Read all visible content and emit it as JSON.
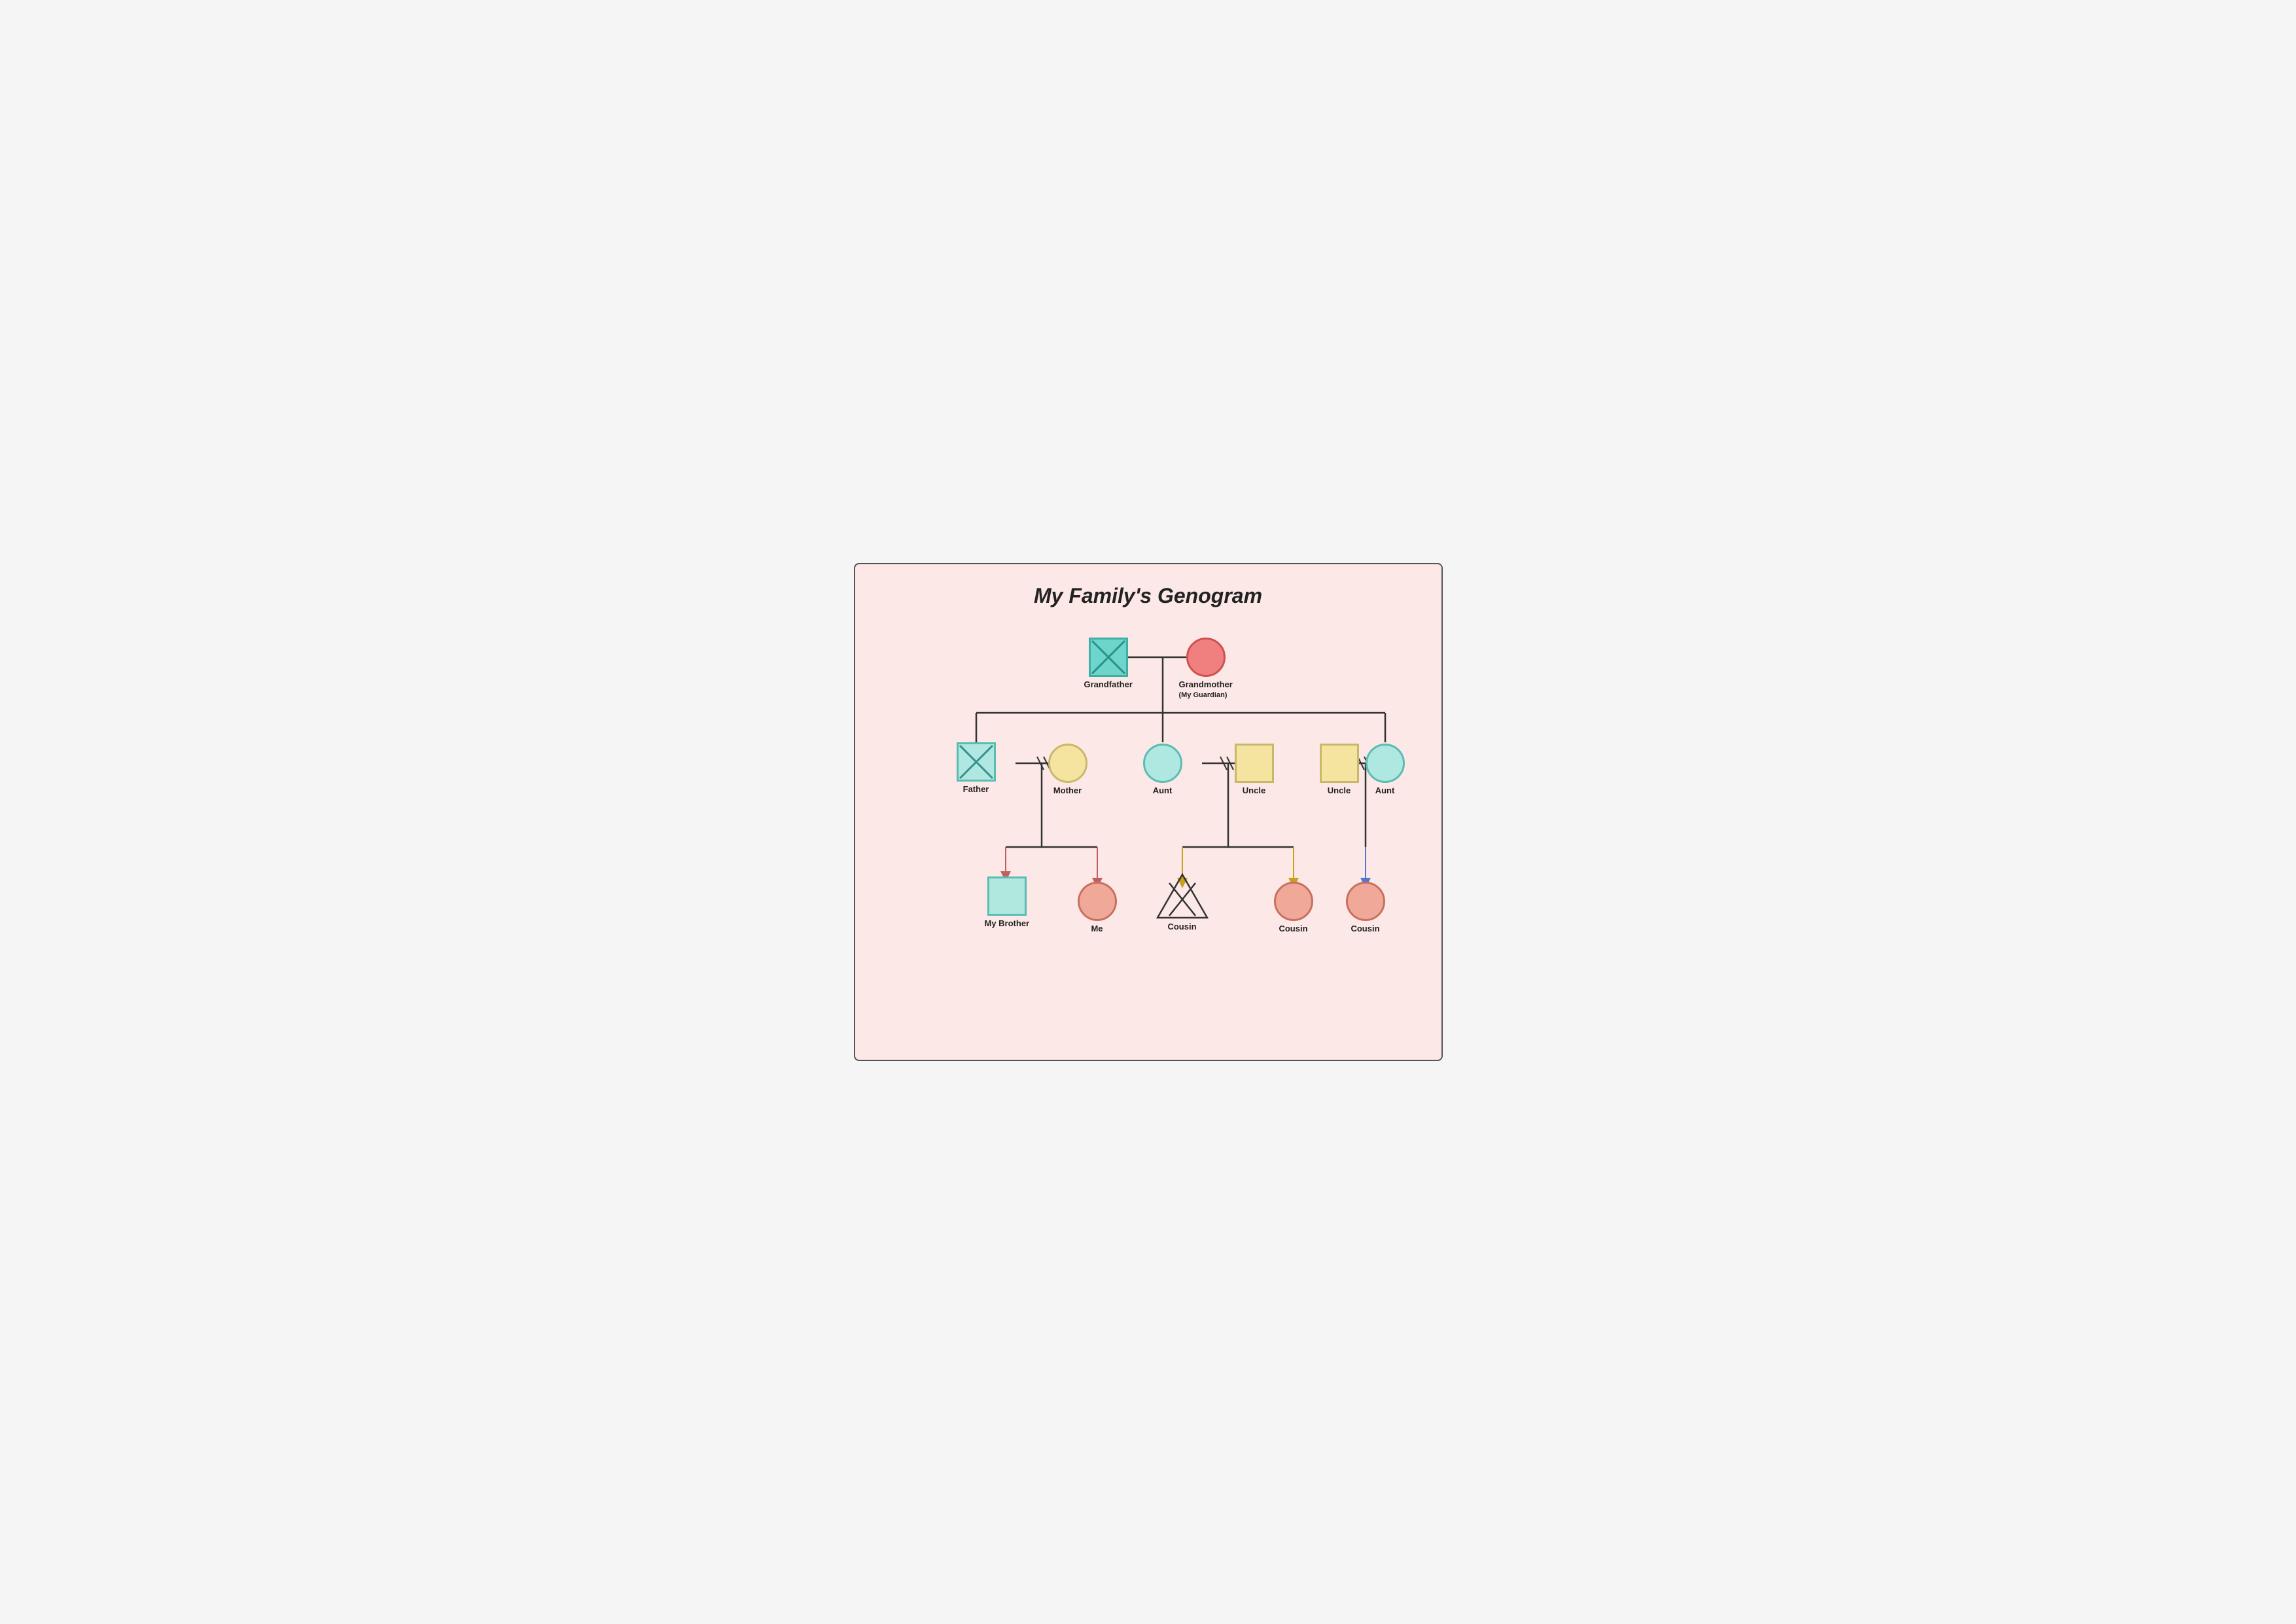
{
  "title": "My Family's Genogram",
  "nodes": {
    "grandfather": {
      "label": "Grandfather",
      "shape": "square-x",
      "color": "teal"
    },
    "grandmother": {
      "label": "Grandmother\n(My Guardian)",
      "shape": "circle",
      "color": "red"
    },
    "father": {
      "label": "Father",
      "shape": "square-x",
      "color": "light-teal"
    },
    "mother": {
      "label": "Mother",
      "shape": "circle",
      "color": "yellow"
    },
    "aunt1": {
      "label": "Aunt",
      "shape": "circle",
      "color": "teal"
    },
    "uncle1": {
      "label": "Uncle",
      "shape": "square",
      "color": "yellow"
    },
    "uncle2": {
      "label": "Uncle",
      "shape": "square",
      "color": "yellow"
    },
    "aunt2": {
      "label": "Aunt",
      "shape": "circle",
      "color": "teal"
    },
    "my_brother": {
      "label": "My Brother",
      "shape": "square",
      "color": "light-teal"
    },
    "me": {
      "label": "Me",
      "shape": "circle",
      "color": "salmon"
    },
    "cousin1": {
      "label": "Cousin",
      "shape": "triangle-x",
      "color": "dark"
    },
    "cousin2": {
      "label": "Cousin",
      "shape": "circle",
      "color": "salmon"
    },
    "cousin3": {
      "label": "Cousin",
      "shape": "circle",
      "color": "salmon"
    }
  }
}
